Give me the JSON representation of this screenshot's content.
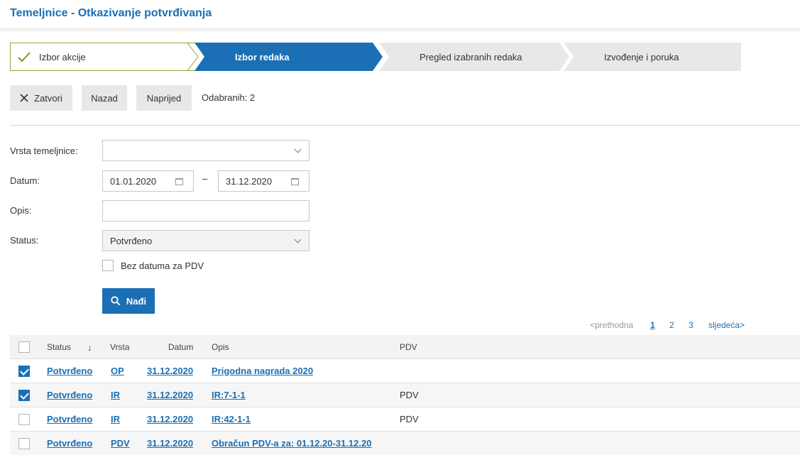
{
  "page": {
    "title": "Temeljnice - Otkazivanje potvrđivanja"
  },
  "wizard": {
    "steps": [
      {
        "label": "Izbor akcije",
        "state": "done"
      },
      {
        "label": "Izbor redaka",
        "state": "active"
      },
      {
        "label": "Pregled izabranih redaka",
        "state": "pending"
      },
      {
        "label": "Izvođenje i poruka",
        "state": "pending"
      }
    ]
  },
  "toolbar": {
    "close_label": "Zatvori",
    "back_label": "Nazad",
    "next_label": "Naprijed",
    "selected_text": "Odabranih: 2"
  },
  "filters": {
    "type_label": "Vrsta temeljnice:",
    "type_value": "",
    "date_label": "Datum:",
    "date_from": "01.01.2020",
    "date_separator": "–",
    "date_to": "31.12.2020",
    "desc_label": "Opis:",
    "desc_value": "",
    "status_label": "Status:",
    "status_value": "Potvrđeno",
    "no_vat_date_label": "Bez datuma za PDV",
    "no_vat_date_checked": false,
    "find_label": "Nađi"
  },
  "pagination": {
    "prev": "<prethodna",
    "pages": [
      "1",
      "2",
      "3"
    ],
    "current": "1",
    "next": "sljedeća>"
  },
  "table": {
    "columns": [
      "Status",
      "Vrsta",
      "Datum",
      "Opis",
      "PDV"
    ],
    "sort_indicator": "↓",
    "rows": [
      {
        "checked": true,
        "status": "Potvrđeno",
        "type": "OP",
        "date": "31.12.2020",
        "desc": "Prigodna nagrada 2020",
        "vat": ""
      },
      {
        "checked": true,
        "status": "Potvrđeno",
        "type": "IR",
        "date": "31.12.2020",
        "desc": "IR:7-1-1",
        "vat": "PDV"
      },
      {
        "checked": false,
        "status": "Potvrđeno",
        "type": "IR",
        "date": "31.12.2020",
        "desc": "IR:42-1-1",
        "vat": "PDV"
      },
      {
        "checked": false,
        "status": "Potvrđeno",
        "type": "PDV",
        "date": "31.12.2020",
        "desc": "Obračun PDV-a za: 01.12.20-31.12.20",
        "vat": ""
      }
    ]
  },
  "colors": {
    "accent": "#1b6fb5",
    "done_border": "#8aab3a",
    "check_green": "#7a9a2a"
  }
}
